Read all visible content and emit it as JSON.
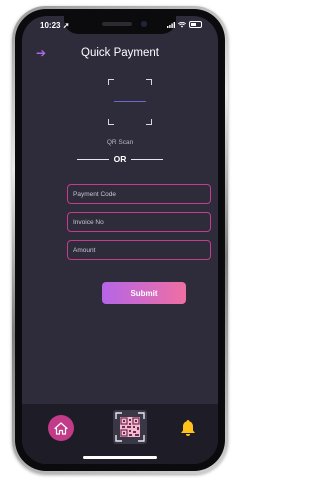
{
  "status_bar": {
    "time": "10:23",
    "location_icon": "location-arrow-icon",
    "signal_icon": "signal-icon",
    "wifi_icon": "wifi-icon",
    "battery_icon": "battery-icon"
  },
  "header": {
    "title": "Quick Payment",
    "back_icon": "back-arrow-icon"
  },
  "qr_scanner": {
    "label": "QR Scan"
  },
  "divider": {
    "text": "OR"
  },
  "form": {
    "payment_code_placeholder": "Payment Code",
    "payment_code_value": "",
    "invoice_placeholder": "Invoice No",
    "invoice_value": "",
    "amount_placeholder": "Amount",
    "amount_value": "",
    "submit_label": "Submit"
  },
  "bottom_nav": {
    "items": [
      {
        "icon": "home-icon"
      },
      {
        "icon": "qr-code-icon"
      },
      {
        "icon": "bell-icon"
      }
    ]
  },
  "colors": {
    "background": "#2e2b3b",
    "accent_purple": "#b565e8",
    "accent_pink": "#ef6fa2",
    "field_border": "#c43c8e",
    "bell": "#ffc21a"
  }
}
